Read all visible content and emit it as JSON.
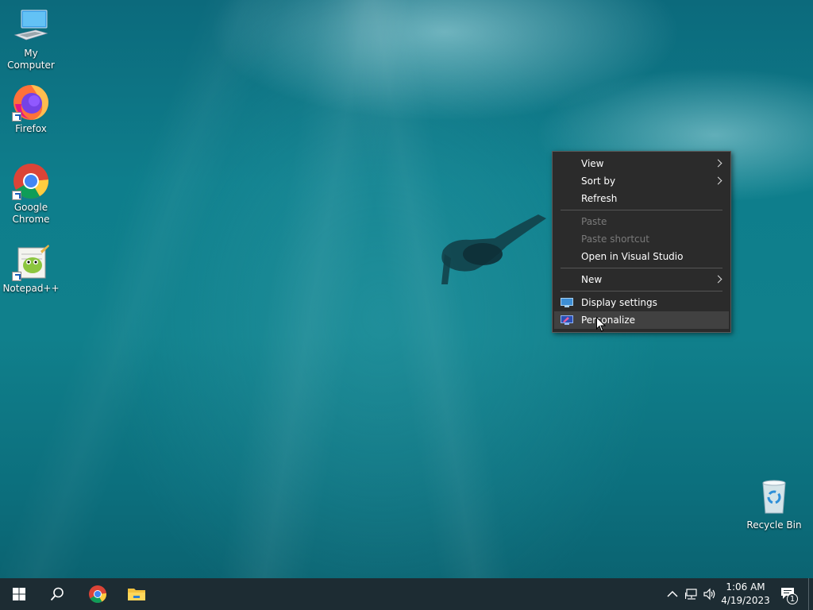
{
  "desktop": {
    "icons": [
      {
        "label": "My Computer",
        "icon": "computer-icon"
      },
      {
        "label": "Firefox",
        "icon": "firefox-icon"
      },
      {
        "label": "Google Chrome",
        "icon": "chrome-icon"
      },
      {
        "label": "Notepad++",
        "icon": "notepad-plus-plus-icon"
      }
    ],
    "recycle_bin": {
      "label": "Recycle Bin",
      "icon": "recycle-bin-icon"
    }
  },
  "context_menu": {
    "items": [
      {
        "label": "View",
        "submenu": true,
        "enabled": true
      },
      {
        "label": "Sort by",
        "submenu": true,
        "enabled": true
      },
      {
        "label": "Refresh",
        "enabled": true
      },
      {
        "label": "Paste",
        "enabled": false
      },
      {
        "label": "Paste shortcut",
        "enabled": false
      },
      {
        "label": "Open in Visual Studio",
        "enabled": true
      },
      {
        "label": "New",
        "submenu": true,
        "enabled": true
      },
      {
        "label": "Display settings",
        "icon": "display-settings-icon",
        "enabled": true
      },
      {
        "label": "Personalize",
        "icon": "personalize-icon",
        "enabled": true,
        "hovered": true
      }
    ]
  },
  "taskbar": {
    "start_icon": "windows-start-icon",
    "search_icon": "search-icon",
    "pinned": [
      "chrome-icon",
      "file-explorer-icon"
    ],
    "tray": {
      "icons": [
        "chevron-up-icon",
        "network-icon",
        "volume-icon"
      ],
      "time": "1:06 AM",
      "date": "4/19/2023",
      "notification_count": "1"
    }
  },
  "colors": {
    "taskbar": "#1d2c33",
    "menu_bg": "#2b2b2b",
    "menu_hover": "#414141",
    "menu_disabled": "#7a7a7a"
  }
}
